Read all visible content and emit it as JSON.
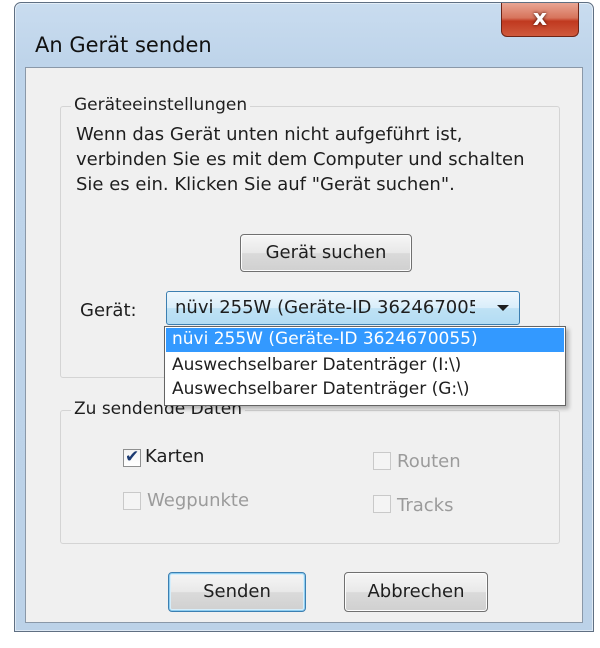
{
  "window": {
    "title": "An Gerät senden",
    "close_label": "x"
  },
  "settings": {
    "legend": "Geräteeinstellungen",
    "description": "Wenn das Gerät unten nicht aufgeführt ist,\nverbinden Sie es mit dem Computer und schalten\nSie es ein. Klicken Sie auf \"Gerät suchen\".",
    "find_button": "Gerät suchen",
    "device_label": "Gerät:",
    "device_selected": "nüvi 255W (Geräte-ID 3624670055)",
    "device_options": [
      "nüvi 255W (Geräte-ID 3624670055)",
      "Auswechselbarer Datenträger (I:\\)",
      "Auswechselbarer Datenträger (G:\\)"
    ]
  },
  "send_data": {
    "legend": "Zu sendende Daten",
    "options": [
      {
        "label": "Karten",
        "checked": true,
        "enabled": true
      },
      {
        "label": "Routen",
        "checked": false,
        "enabled": false
      },
      {
        "label": "Wegpunkte",
        "checked": false,
        "enabled": false
      },
      {
        "label": "Tracks",
        "checked": false,
        "enabled": false
      }
    ]
  },
  "actions": {
    "send": "Senden",
    "cancel": "Abbrechen"
  },
  "colors": {
    "selection": "#3399ff",
    "accent_border": "#3c7fb1",
    "close_red": "#c0391f"
  }
}
